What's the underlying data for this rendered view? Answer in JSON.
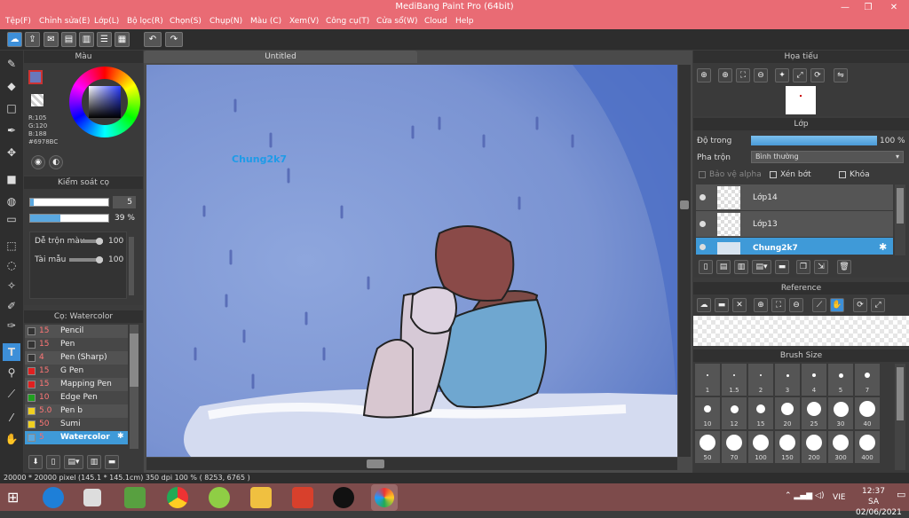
{
  "app": {
    "title": "MediBang Paint Pro (64bit)"
  },
  "window": {
    "minimize": "—",
    "maximize": "❐",
    "close": "✕"
  },
  "menu": [
    "Tệp(F)",
    "Chỉnh sửa(E)",
    "Lớp(L)",
    "Bộ lọc(R)",
    "Chọn(S)",
    "Chụp(N)",
    "Màu (C)",
    "Xem(V)",
    "Công cụ(T)",
    "Cửa sổ(W)",
    "Cloud",
    "Help"
  ],
  "color_panel": {
    "title": "Màu",
    "r": "R:105",
    "g": "G:120",
    "b": "B:188",
    "hex": "#6978BC",
    "color": "#6978BC"
  },
  "brush_control": {
    "title": "Kiểm soát cọ",
    "size": "5",
    "opacity": "39 %",
    "blend_label": "Dễ trộn màu",
    "blend_value": "100",
    "resource_label": "Tài mẫu",
    "resource_value": "100"
  },
  "brush_list": {
    "title": "Cọ: Watercolor",
    "items": [
      {
        "size": "15",
        "name": "Pencil",
        "color": "#333333"
      },
      {
        "size": "15",
        "name": "Pen",
        "color": "#333333"
      },
      {
        "size": "4",
        "name": "Pen (Sharp)",
        "color": "#333333"
      },
      {
        "size": "15",
        "name": "G Pen",
        "color": "#e02020"
      },
      {
        "size": "15",
        "name": "Mapping Pen",
        "color": "#e02020"
      },
      {
        "size": "10",
        "name": "Edge Pen",
        "color": "#20a020"
      },
      {
        "size": "5.0",
        "name": "Pen b",
        "color": "#f0d020"
      },
      {
        "size": "50",
        "name": "Sumi",
        "color": "#f0d020"
      },
      {
        "size": "5",
        "name": "Watercolor",
        "color": "#5aa8e0"
      }
    ]
  },
  "canvas": {
    "tab": "Untitled",
    "signature": "Chung2k7"
  },
  "navigator": {
    "title": "Họa tiếu"
  },
  "layers": {
    "title": "Lớp",
    "opacity_label": "Độ trong",
    "opacity_value": "100 %",
    "blend_label": "Pha trộn",
    "blend_value": "Bình thường",
    "protect_alpha": "Bảo vệ alpha",
    "clipping": "Xén bớt",
    "lock": "Khóa",
    "items": [
      {
        "name": "Lớp14"
      },
      {
        "name": "Lớp13"
      },
      {
        "name": "Chung2k7"
      }
    ]
  },
  "reference": {
    "title": "Reference"
  },
  "brush_size": {
    "title": "Brush Size",
    "sizes": [
      "1",
      "1.5",
      "2",
      "3",
      "4",
      "5",
      "7",
      "10",
      "12",
      "15",
      "20",
      "25",
      "30",
      "40",
      "50",
      "70",
      "100",
      "150",
      "200",
      "300",
      "400"
    ]
  },
  "status": {
    "text": "20000 * 20000 pixel   (145.1 * 145.1cm)   350 dpi   100 %   ( 8253, 6765 )"
  },
  "taskbar": {
    "time": "12:37 SA",
    "date": "02/06/2021",
    "lang": "VIE"
  }
}
